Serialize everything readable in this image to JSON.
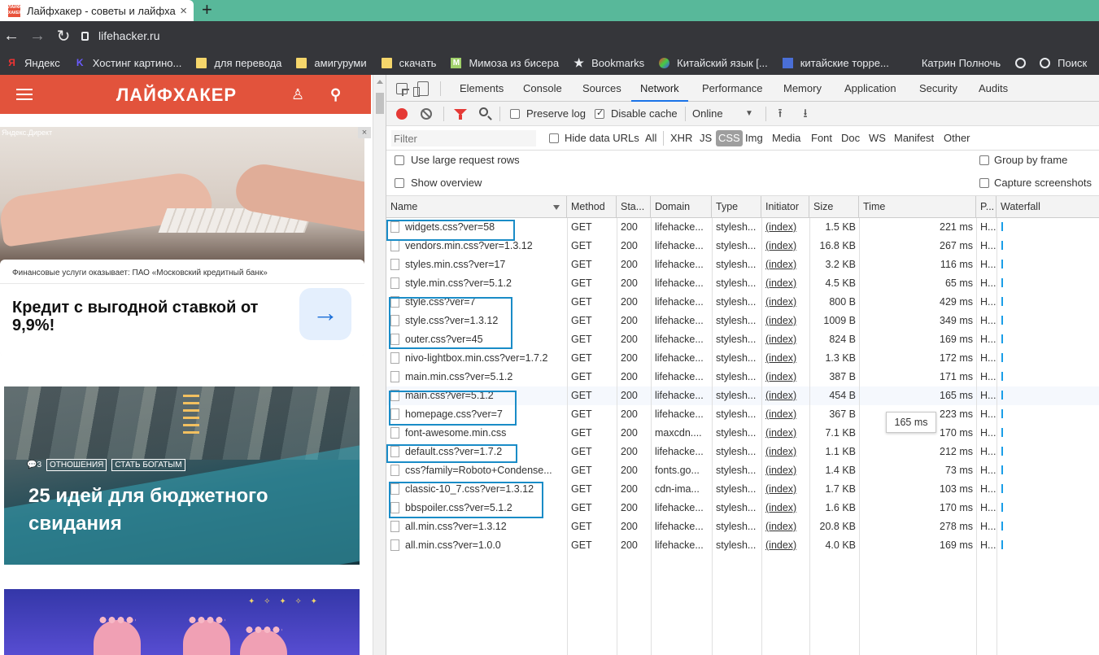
{
  "browser": {
    "tab_title": "Лайфхакер - советы и лайфха",
    "favicon_text": "ЛАЙФ ХАКЕР",
    "tab_close": "×",
    "new_tab": "+",
    "back": "←",
    "forward": "→",
    "reload": "↻",
    "url": "lifehacker.ru",
    "bookmarks": [
      {
        "label": "Яндекс",
        "icon": "yandex-icon",
        "glyph": "Я"
      },
      {
        "label": "Хостинг картино...",
        "icon": "k-icon",
        "glyph": "K"
      },
      {
        "label": "для перевода",
        "icon": "folder-icon",
        "glyph": ""
      },
      {
        "label": "амигуруми",
        "icon": "folder-icon",
        "glyph": ""
      },
      {
        "label": "скачать",
        "icon": "folder-icon",
        "glyph": ""
      },
      {
        "label": "Мимоза из бисера",
        "icon": "m-icon",
        "glyph": "M"
      },
      {
        "label": "Bookmarks",
        "icon": "star-icon",
        "glyph": "★"
      },
      {
        "label": "Китайский язык [...",
        "icon": "site-icon",
        "glyph": ""
      },
      {
        "label": "китайские торре...",
        "icon": "site-icon",
        "glyph": ""
      },
      {
        "label": "Катрин Полночь",
        "icon": "site-icon",
        "glyph": ""
      },
      {
        "label": "",
        "icon": "globe-icon",
        "glyph": ""
      },
      {
        "label": "Поиск",
        "icon": "globe-icon",
        "glyph": ""
      }
    ]
  },
  "site": {
    "logo": "ЛАЙФХАКЕР",
    "user_icon": "♙",
    "search_icon": "⚲",
    "ad": {
      "label": "Яндекс.Директ",
      "close": "×",
      "note": "Финансовые услуги оказывает: ПАО «Московский кредитный банк»",
      "title": "Кредит с выгодной ставкой от 9,9%!",
      "arrow": "→"
    },
    "article": {
      "comments": "💬3",
      "tags": [
        "ОТНОШЕНИЯ",
        "СТАТЬ БОГАТЫМ"
      ],
      "title": "25 идей для бюджетного свидания"
    },
    "article2_stars": "✦ ✧ ✦ ✧ ✦"
  },
  "devtools": {
    "tabs": [
      "Elements",
      "Console",
      "Sources",
      "Network",
      "Performance",
      "Memory",
      "Application",
      "Security",
      "Audits"
    ],
    "active_tab": "Network",
    "toolbar": {
      "preserve_log": "Preserve log",
      "preserve_log_checked": false,
      "disable_cache": "Disable cache",
      "disable_cache_checked": true,
      "throttling": "Online",
      "throttle_arrow": "▼",
      "upload_icon": "⭱",
      "download_icon": "⭳"
    },
    "filter": {
      "placeholder": "Filter",
      "hide_data_urls": "Hide data URLs",
      "types": [
        "All",
        "XHR",
        "JS",
        "CSS",
        "Img",
        "Media",
        "Font",
        "Doc",
        "WS",
        "Manifest",
        "Other"
      ],
      "selected_type": "CSS"
    },
    "options": {
      "large_rows": "Use large request rows",
      "show_overview": "Show overview",
      "group_by_frame": "Group by frame",
      "capture_screenshots": "Capture screenshots"
    },
    "columns": [
      "Name",
      "Method",
      "Sta...",
      "Domain",
      "Type",
      "Initiator",
      "Size",
      "Time",
      "P...",
      "Waterfall"
    ],
    "rows": [
      {
        "name": "widgets.css?ver=58",
        "method": "GET",
        "status": "200",
        "domain": "lifehacke...",
        "type": "stylesh...",
        "initiator": "(index)",
        "size": "1.5 KB",
        "time": "221 ms",
        "p": "H..."
      },
      {
        "name": "vendors.min.css?ver=1.3.12",
        "method": "GET",
        "status": "200",
        "domain": "lifehacke...",
        "type": "stylesh...",
        "initiator": "(index)",
        "size": "16.8 KB",
        "time": "267 ms",
        "p": "H..."
      },
      {
        "name": "styles.min.css?ver=17",
        "method": "GET",
        "status": "200",
        "domain": "lifehacke...",
        "type": "stylesh...",
        "initiator": "(index)",
        "size": "3.2 KB",
        "time": "116 ms",
        "p": "H..."
      },
      {
        "name": "style.min.css?ver=5.1.2",
        "method": "GET",
        "status": "200",
        "domain": "lifehacke...",
        "type": "stylesh...",
        "initiator": "(index)",
        "size": "4.5 KB",
        "time": "65 ms",
        "p": "H..."
      },
      {
        "name": "style.css?ver=7",
        "method": "GET",
        "status": "200",
        "domain": "lifehacke...",
        "type": "stylesh...",
        "initiator": "(index)",
        "size": "800 B",
        "time": "429 ms",
        "p": "H..."
      },
      {
        "name": "style.css?ver=1.3.12",
        "method": "GET",
        "status": "200",
        "domain": "lifehacke...",
        "type": "stylesh...",
        "initiator": "(index)",
        "size": "1009 B",
        "time": "349 ms",
        "p": "H..."
      },
      {
        "name": "outer.css?ver=45",
        "method": "GET",
        "status": "200",
        "domain": "lifehacke...",
        "type": "stylesh...",
        "initiator": "(index)",
        "size": "824 B",
        "time": "169 ms",
        "p": "H..."
      },
      {
        "name": "nivo-lightbox.min.css?ver=1.7.2",
        "method": "GET",
        "status": "200",
        "domain": "lifehacke...",
        "type": "stylesh...",
        "initiator": "(index)",
        "size": "1.3 KB",
        "time": "172 ms",
        "p": "H..."
      },
      {
        "name": "main.min.css?ver=5.1.2",
        "method": "GET",
        "status": "200",
        "domain": "lifehacke...",
        "type": "stylesh...",
        "initiator": "(index)",
        "size": "387 B",
        "time": "171 ms",
        "p": "H..."
      },
      {
        "name": "main.css?ver=5.1.2",
        "method": "GET",
        "status": "200",
        "domain": "lifehacke...",
        "type": "stylesh...",
        "initiator": "(index)",
        "size": "454 B",
        "time": "165 ms",
        "p": "H..."
      },
      {
        "name": "homepage.css?ver=7",
        "method": "GET",
        "status": "200",
        "domain": "lifehacke...",
        "type": "stylesh...",
        "initiator": "(index)",
        "size": "367 B",
        "time": "223 ms",
        "p": "H..."
      },
      {
        "name": "font-awesome.min.css",
        "method": "GET",
        "status": "200",
        "domain": "maxcdn....",
        "type": "stylesh...",
        "initiator": "(index)",
        "size": "7.1 KB",
        "time": "170 ms",
        "p": "H..."
      },
      {
        "name": "default.css?ver=1.7.2",
        "method": "GET",
        "status": "200",
        "domain": "lifehacke...",
        "type": "stylesh...",
        "initiator": "(index)",
        "size": "1.1 KB",
        "time": "212 ms",
        "p": "H..."
      },
      {
        "name": "css?family=Roboto+Condense...",
        "method": "GET",
        "status": "200",
        "domain": "fonts.go...",
        "type": "stylesh...",
        "initiator": "(index)",
        "size": "1.4 KB",
        "time": "73 ms",
        "p": "H..."
      },
      {
        "name": "classic-10_7.css?ver=1.3.12",
        "method": "GET",
        "status": "200",
        "domain": "cdn-ima...",
        "type": "stylesh...",
        "initiator": "(index)",
        "size": "1.7 KB",
        "time": "103 ms",
        "p": "H..."
      },
      {
        "name": "bbspoiler.css?ver=5.1.2",
        "method": "GET",
        "status": "200",
        "domain": "lifehacke...",
        "type": "stylesh...",
        "initiator": "(index)",
        "size": "1.6 KB",
        "time": "170 ms",
        "p": "H..."
      },
      {
        "name": "all.min.css?ver=1.3.12",
        "method": "GET",
        "status": "200",
        "domain": "lifehacke...",
        "type": "stylesh...",
        "initiator": "(index)",
        "size": "20.8 KB",
        "time": "278 ms",
        "p": "H..."
      },
      {
        "name": "all.min.css?ver=1.0.0",
        "method": "GET",
        "status": "200",
        "domain": "lifehacke...",
        "type": "stylesh...",
        "initiator": "(index)",
        "size": "4.0 KB",
        "time": "169 ms",
        "p": "H..."
      }
    ],
    "tooltip": "165 ms",
    "accent_color": "#1a73e8",
    "highlight_color": "#1a8cc7"
  }
}
